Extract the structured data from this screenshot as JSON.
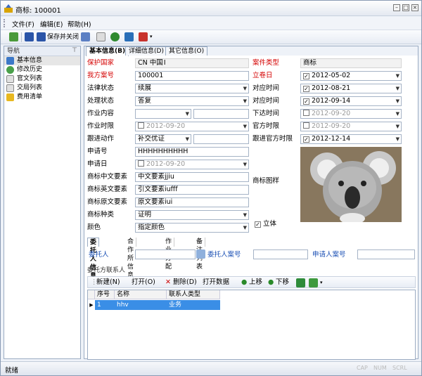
{
  "window": {
    "title": "商标: 100001"
  },
  "menu": [
    "文件(F)",
    "编辑(E)",
    "帮助(H)"
  ],
  "toolbar": {
    "save_close": "保存并关闭"
  },
  "nav": {
    "header": "导航",
    "pin": "⊤",
    "items": [
      "基本信息",
      "修改历史",
      "官文列表",
      "交局列表",
      "费用清单"
    ]
  },
  "tabs": [
    "基本信息(B)",
    "详细信息(D)",
    "其它信息(O)"
  ],
  "form": {
    "protect_country_label": "保护国家",
    "protect_country": "CN 中国",
    "case_type_label": "案件类型",
    "case_type": "商标",
    "our_ref_label": "我方案号",
    "our_ref": "100001",
    "filing_date_label": "立卷日",
    "filing_date": "2012-05-02",
    "legal_status_label": "法律状态",
    "legal_status": "续展",
    "counter_time1_label": "对应时间",
    "counter_time1": "2012-08-21",
    "handle_status_label": "处理状态",
    "handle_status": "答复",
    "counter_time2_label": "对应时间",
    "counter_time2": "2012-09-14",
    "task_content_label": "作业内容",
    "issue_time_label": "下达时间",
    "issue_time": "2012-09-20",
    "task_deadline_label": "作业时限",
    "task_deadline": "2012-09-20",
    "official_deadline_label": "官方时限",
    "official_deadline": "2012-09-20",
    "follow_action_label": "跟进动作",
    "follow_action": "补交优证",
    "follow_official_label": "跟进官方时限",
    "follow_official": "2012-12-14",
    "app_no_label": "申请号",
    "app_no": "HHHHHHHHHH",
    "app_date_label": "申请日",
    "app_date": "2012-09-20",
    "tm_cn_label": "商标中文要素",
    "tm_cn": "中文要素jjiu",
    "tm_en_label": "商标英文要素",
    "tm_en": "引文要素iufff",
    "tm_orig_label": "商标原文要素",
    "tm_orig": "原文要素iui",
    "tm_image_label": "商标图样",
    "tm_kind_label": "商标种类",
    "tm_kind": "证明",
    "color_label": "颜色",
    "color": "指定颜色",
    "solid_label": "立体"
  },
  "subtabs": [
    "委托人信息",
    "合作所信息",
    "作业分配",
    "备注列表"
  ],
  "client": {
    "client_label": "委托人",
    "client_ref_label": "委托人案号",
    "applicant_ref_label": "申请人案号"
  },
  "contacts": {
    "group_label": "委托方联系人",
    "new": "新建(N)",
    "open": "打开(O)",
    "delete": "删除(D)",
    "open_data": "打开数据",
    "up": "上移",
    "down": "下移",
    "columns": [
      "序号",
      "名称",
      "联系人类型"
    ],
    "rows": [
      {
        "no": "1",
        "name": "hhv",
        "type": "业务"
      }
    ]
  },
  "status": {
    "text": "就绪",
    "caps": "CAP",
    "num": "NUM",
    "scrl": "SCRL"
  }
}
